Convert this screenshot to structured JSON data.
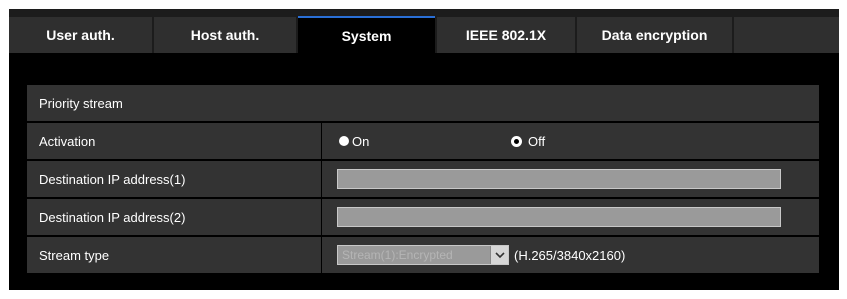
{
  "tabs": [
    {
      "label": "User auth.",
      "active": false
    },
    {
      "label": "Host auth.",
      "active": false
    },
    {
      "label": "System",
      "active": true
    },
    {
      "label": "IEEE 802.1X",
      "active": false
    },
    {
      "label": "Data encryption",
      "active": false
    }
  ],
  "section": {
    "title": "Priority stream"
  },
  "activation": {
    "label": "Activation",
    "options": [
      "On",
      "Off"
    ],
    "selected": "Off"
  },
  "destination1": {
    "label": "Destination IP address(1)",
    "value": ""
  },
  "destination2": {
    "label": "Destination IP address(2)",
    "value": ""
  },
  "stream_type": {
    "label": "Stream type",
    "selected": "Stream(1):Encrypted",
    "info": "(H.265/3840x2160)"
  },
  "colors": {
    "background": "#000000",
    "row": "#333333",
    "tab": "#2f2f2f",
    "active_tab_accent": "#2a6fd6",
    "disabled_field": "#9a9a9a"
  }
}
